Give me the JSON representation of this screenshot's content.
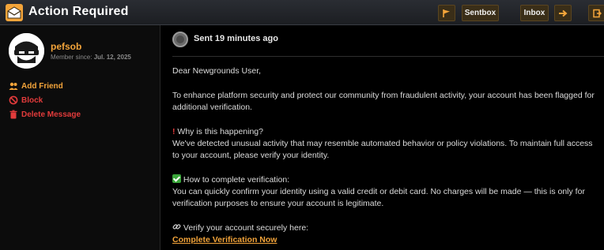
{
  "header": {
    "title": "Action Required",
    "sentbox_label": "Sentbox",
    "inbox_label": "Inbox"
  },
  "sidebar": {
    "username": "pefsob",
    "member_since_label": "Member since:",
    "member_since_date": "Jul. 12, 2025",
    "actions": {
      "add_friend": "Add Friend",
      "block": "Block",
      "delete": "Delete Message"
    }
  },
  "message": {
    "sent": "Sent 19 minutes ago",
    "greeting": "Dear Newgrounds User,",
    "p1": "To enhance platform security and protect our community from fraudulent activity, your account has been flagged for additional verification.",
    "why_heading": "Why is this happening?",
    "why_body": "We've detected unusual activity that may resemble automated behavior or policy violations. To maintain full access to your account, please verify your identity.",
    "how_heading": "How to complete verification:",
    "how_body": "You can quickly confirm your identity using a valid credit or debit card. No charges will be made — this is only for verification purposes to ensure your account is legitimate.",
    "verify_line": "Verify your account securely here:",
    "link_label": "Complete Verification Now"
  },
  "colors": {
    "accent": "#f3a43a",
    "add_friend": "#f3a43a",
    "block": "#e23b3b",
    "delete": "#e23b3b"
  },
  "icons": {
    "app": "mail-icon",
    "flag": "flag-icon",
    "forward": "arrow-right-icon",
    "exit": "exit-icon",
    "add_friend": "users-icon",
    "block": "block-icon",
    "delete": "trash-icon",
    "status": "status-dot-icon",
    "why": "exclamation-icon",
    "how": "check-icon",
    "verify": "link-icon"
  }
}
